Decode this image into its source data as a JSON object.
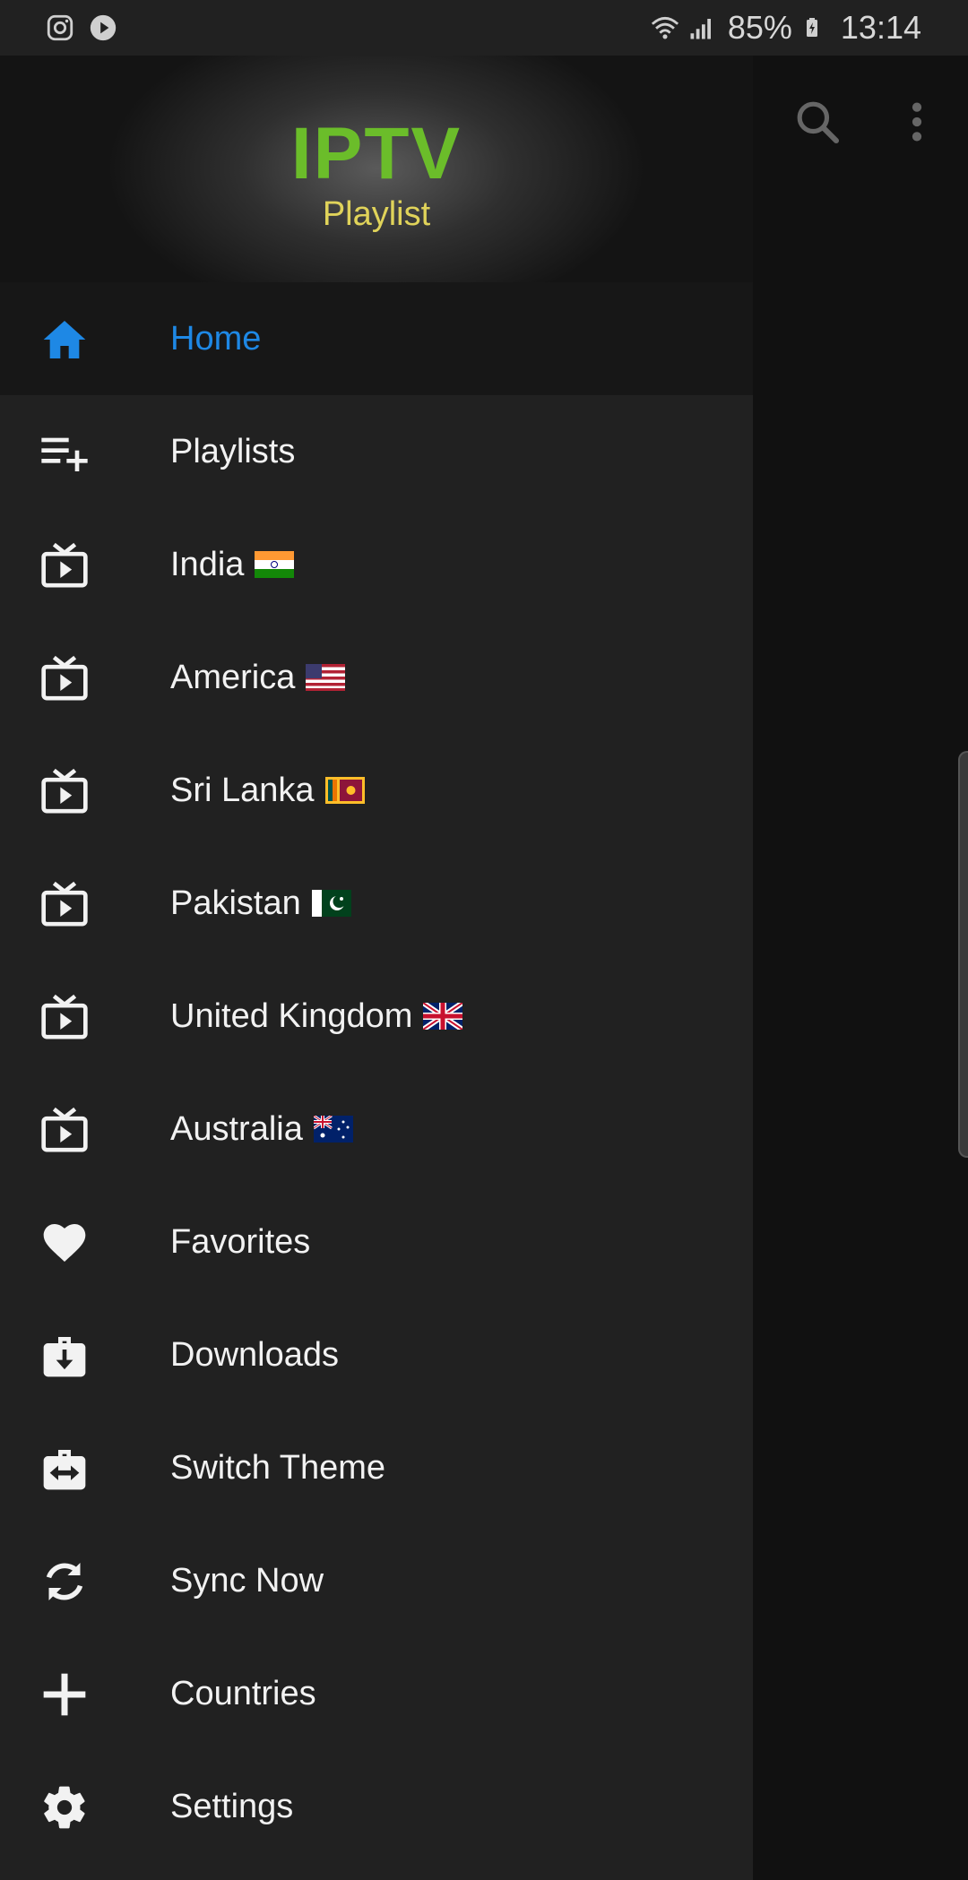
{
  "status_bar": {
    "battery": "85%",
    "time": "13:14",
    "icons": [
      "instagram-icon",
      "play-icon",
      "wifi-icon",
      "signal-icon",
      "battery-charging-icon"
    ]
  },
  "header": {
    "logo_title": "IPTV",
    "logo_subtitle": "Playlist"
  },
  "app_bar": {
    "icons": [
      "search-icon",
      "more-vert-icon"
    ]
  },
  "colors": {
    "accent": "#1e88e5",
    "logo_green": "#6bbd2a",
    "logo_yellow": "#e0d35a",
    "drawer_bg": "#212121"
  },
  "nav": {
    "items": [
      {
        "label": "Home",
        "icon": "home-icon",
        "active": true
      },
      {
        "label": "Playlists",
        "icon": "playlist-add-icon"
      },
      {
        "label": "India",
        "icon": "tv-icon",
        "flag": "india-flag"
      },
      {
        "label": "America",
        "icon": "tv-icon",
        "flag": "usa-flag"
      },
      {
        "label": "Sri Lanka",
        "icon": "tv-icon",
        "flag": "sri-lanka-flag"
      },
      {
        "label": "Pakistan",
        "icon": "tv-icon",
        "flag": "pakistan-flag"
      },
      {
        "label": "United Kingdom",
        "icon": "tv-icon",
        "flag": "uk-flag"
      },
      {
        "label": "Australia",
        "icon": "tv-icon",
        "flag": "australia-flag"
      },
      {
        "label": "Favorites",
        "icon": "heart-icon"
      },
      {
        "label": "Downloads",
        "icon": "download-icon"
      },
      {
        "label": "Switch Theme",
        "icon": "switch-theme-icon"
      },
      {
        "label": "Sync Now",
        "icon": "sync-icon"
      },
      {
        "label": "Countries",
        "icon": "plus-icon"
      },
      {
        "label": "Settings",
        "icon": "settings-icon"
      }
    ]
  }
}
